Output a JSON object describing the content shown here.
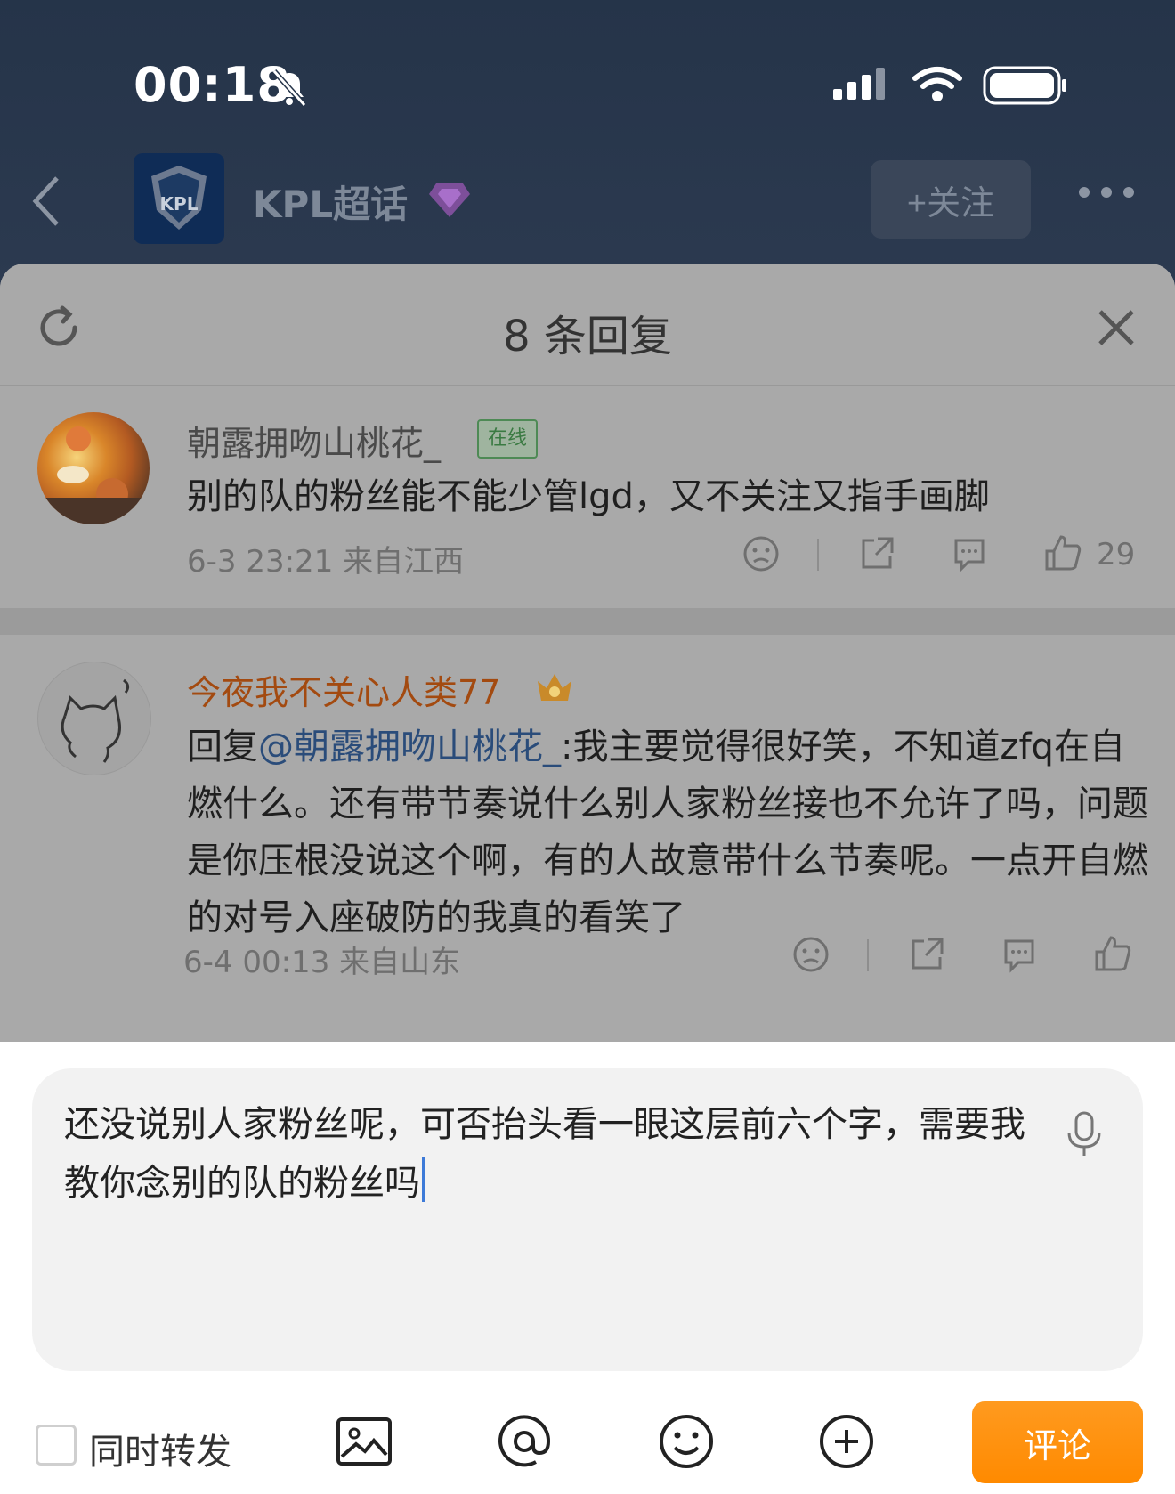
{
  "status_bar": {
    "time": "00:18"
  },
  "header": {
    "title": "KPL超话",
    "follow_label": "+关注",
    "logo_text": "KPL"
  },
  "sheet": {
    "title": "8 条回复"
  },
  "comments": [
    {
      "username": "朝露拥吻山桃花_",
      "badge": "在线",
      "text": "别的队的粉丝能不能少管lgd，又不关注又指手画脚",
      "meta": "6-3 23:21 来自江西",
      "likes": "29"
    },
    {
      "username": "今夜我不关心人类77",
      "reply_prefix": "回复",
      "mention": "@朝露拥吻山桃花_",
      "text": ":我主要觉得很好笑，不知道zfq在自燃什么。还有带节奏说什么别人家粉丝接也不允许了吗，问题是你压根没说这个啊，有的人故意带什么节奏呢。一点开自燃的对号入座破防的我真的看笑了",
      "meta": "6-4 00:13 来自山东",
      "likes": ""
    }
  ],
  "composer": {
    "input_text": "还没说别人家粉丝呢，可否抬头看一眼这层前六个字，需要我教你念别的队的粉丝吗",
    "repost_label": "同时转发",
    "submit_label": "评论"
  },
  "colors": {
    "accent": "#ff8a00",
    "mention": "#2a4c7a",
    "username_vip": "#a34a10"
  }
}
